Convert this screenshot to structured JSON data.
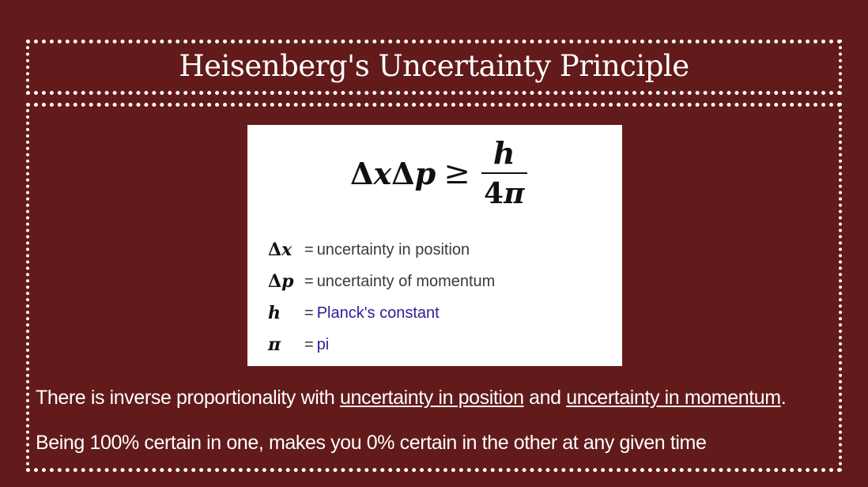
{
  "slide": {
    "title": "Heisenberg's Uncertainty Principle",
    "background_color": "#621a1a"
  },
  "equation": {
    "lhs_delta1": "Δ",
    "lhs_x": "x",
    "lhs_delta2": "Δ",
    "lhs_p": "p",
    "relation": "≥",
    "numerator": "h",
    "denominator_number": "4",
    "denominator_symbol": "π"
  },
  "definitions": [
    {
      "symbol_delta": "Δ",
      "symbol_var": "x",
      "eq": "=",
      "text": "uncertainty in position",
      "style": "plain"
    },
    {
      "symbol_delta": "Δ",
      "symbol_var": "p",
      "eq": "=",
      "text": "uncertainty of momentum",
      "style": "plain"
    },
    {
      "symbol_delta": "",
      "symbol_var": "h",
      "eq": "=",
      "text": "Planck's constant",
      "style": "link"
    },
    {
      "symbol_delta": "",
      "symbol_var": "π",
      "eq": "=",
      "text": "pi",
      "style": "link"
    }
  ],
  "bottom_text": {
    "line1_a": "There is inverse proportionality with ",
    "line1_b": "uncertainty in position",
    "line1_c": " and ",
    "line1_d": "uncertainty in momentum",
    "line1_e": ".",
    "line2": "Being 100% certain in one, makes you 0% certain in the other at any given time"
  },
  "colors": {
    "definition_link": "#2a1f96",
    "text_on_background": "#ffffff"
  }
}
